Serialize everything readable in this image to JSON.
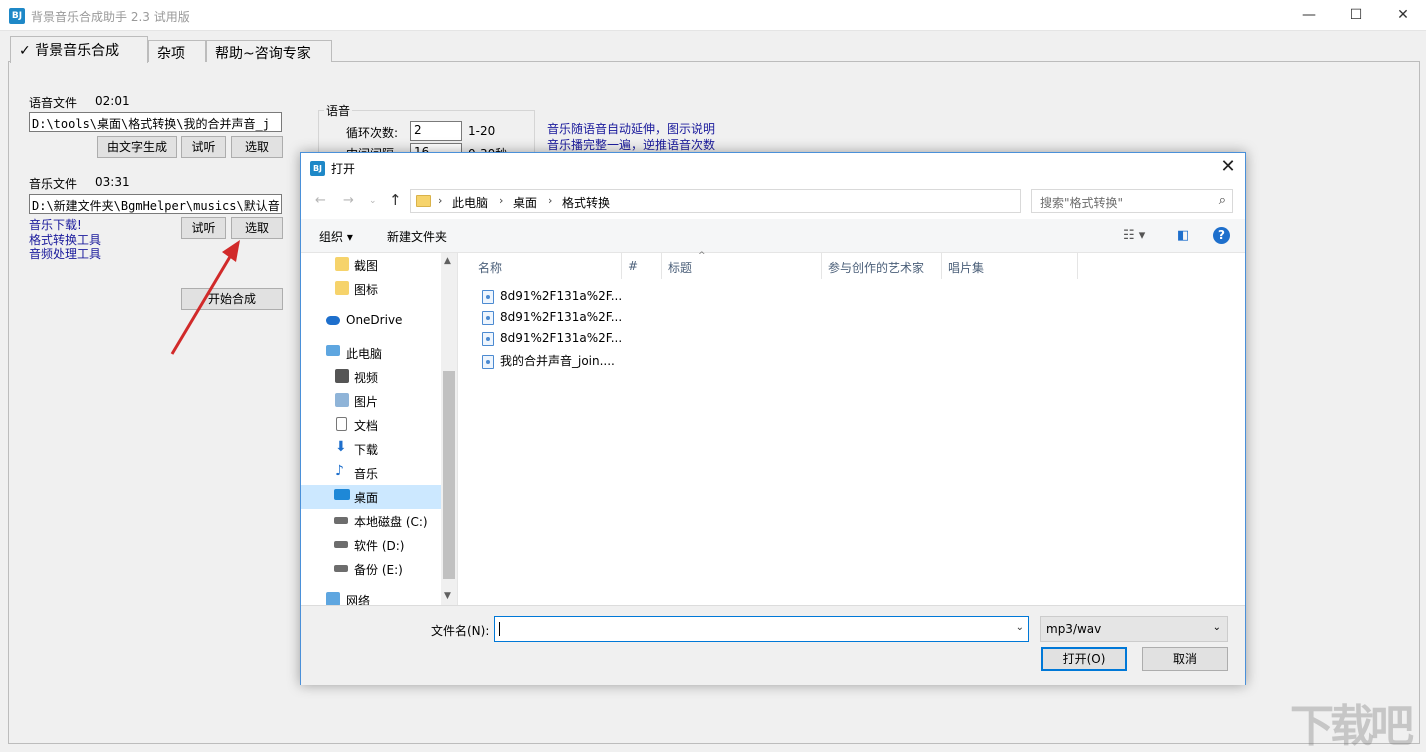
{
  "app": {
    "title": "背景音乐合成助手 2.3 试用版",
    "icon_text": "BJ"
  },
  "window_controls": {
    "minimize": "—",
    "maximize": "☐",
    "close": "✕"
  },
  "tabs": [
    {
      "label": "✓ 背景音乐合成"
    },
    {
      "label": "杂项"
    },
    {
      "label": "帮助~咨询专家"
    }
  ],
  "voice": {
    "label": "语音文件",
    "duration": "02:01",
    "path": "D:\\tools\\桌面\\格式转换\\我的合并声音_j",
    "btn_text": "由文字生成",
    "btn_listen": "试听",
    "btn_select": "选取"
  },
  "music": {
    "label": "音乐文件",
    "duration": "03:31",
    "path": "D:\\新建文件夹\\BgmHelper\\musics\\默认音",
    "btn_listen": "试听",
    "btn_select": "选取"
  },
  "links": [
    "音乐下载!",
    "格式转换工具",
    "音频处理工具"
  ],
  "start_button": "开始合成",
  "voice_group": {
    "title": "语音",
    "loop_label": "循环次数:",
    "loop_value": "2",
    "loop_range": "1-20",
    "interval_label": "中间间隔",
    "interval_value": "16",
    "interval_range": "0-30秒"
  },
  "hints": [
    "音乐随语音自动延伸，图示说明",
    "音乐播完整一遍，逆推语音次数"
  ],
  "dialog": {
    "title": "打开",
    "icon_text": "BJ",
    "close": "✕",
    "breadcrumbs": [
      "此电脑",
      "桌面",
      "格式转换"
    ],
    "search_placeholder": "搜索\"格式转换\"",
    "organize": "组织 ▾",
    "new_folder": "新建文件夹",
    "help": "?",
    "nav_items": [
      {
        "label": "截图",
        "icon": "folder-icon"
      },
      {
        "label": "图标",
        "icon": "folder-icon"
      },
      {
        "label": "OneDrive",
        "icon": "cloud-icon"
      },
      {
        "label": "此电脑",
        "icon": "computer-icon"
      },
      {
        "label": "视频",
        "icon": "video-icon"
      },
      {
        "label": "图片",
        "icon": "pictures-icon"
      },
      {
        "label": "文档",
        "icon": "documents-icon"
      },
      {
        "label": "下载",
        "icon": "download-icon"
      },
      {
        "label": "音乐",
        "icon": "music-icon"
      },
      {
        "label": "桌面",
        "icon": "desktop-icon"
      },
      {
        "label": "本地磁盘 (C:)",
        "icon": "drive-icon"
      },
      {
        "label": "软件 (D:)",
        "icon": "drive-icon"
      },
      {
        "label": "备份 (E:)",
        "icon": "drive-icon"
      },
      {
        "label": "网络",
        "icon": "network-icon"
      }
    ],
    "columns": [
      "名称",
      "#",
      "标题",
      "参与创作的艺术家",
      "唱片集"
    ],
    "files": [
      "8d91%2F131a%2F...",
      "8d91%2F131a%2F...",
      "8d91%2F131a%2F...",
      "我的合并声音_join...."
    ],
    "filename_label": "文件名(N):",
    "filename_value": "",
    "filetype": "mp3/wav",
    "open_btn": "打开(O)",
    "cancel_btn": "取消"
  },
  "colors": {
    "accent": "#0078d7",
    "link": "#1a1a9c",
    "selection": "#cce8ff",
    "arrow": "#d12a2a"
  }
}
